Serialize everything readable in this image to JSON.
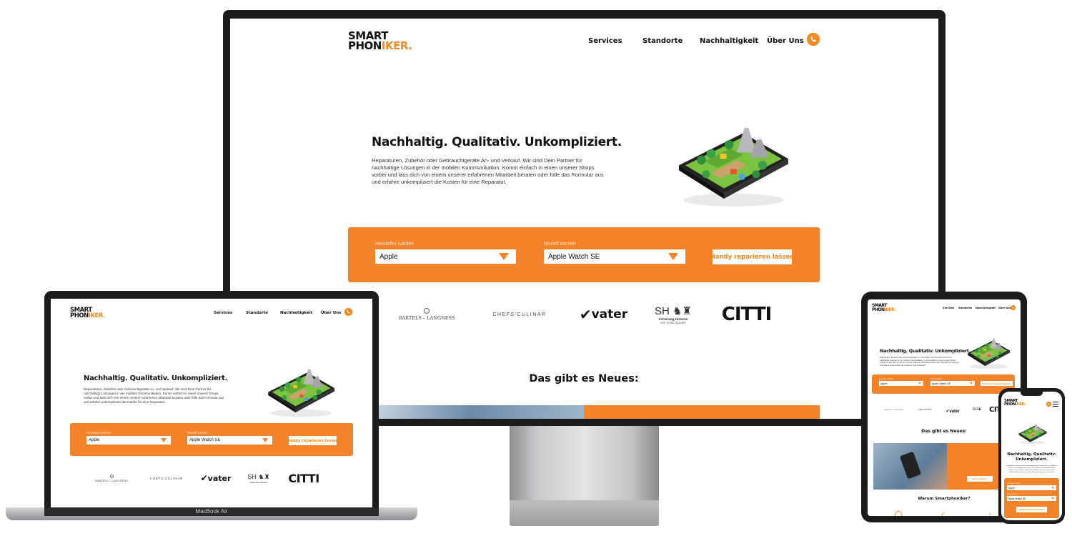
{
  "site": {
    "logo_line1": "SMART",
    "logo_line2_main": "PHON",
    "logo_line2_accent": "IKER.",
    "nav": [
      "Services",
      "Standorte",
      "Nachhaltigkeit",
      "Über Uns"
    ],
    "hero_title": "Nachhaltig. Qualitativ. Unkompliziert.",
    "hero_title_phone_l1": "Nachhaltig. Qualitativ.",
    "hero_title_phone_l2": "Unkompliziert.",
    "hero_text": "Reparaturen, Zubehör oder Gebrauchtgeräte An- und Verkauf. Wir sind Dein Partner für nachhaltige Lösungen in der mobilen Kommunikation. Komm einfach in einen unserer Shops vorbei und lass dich von einem unserer erfahrenen Mitarbeit beraten oder fülle das Formular aus und erfahre unkompliziert die Kosten für eine Reparatur.",
    "form": {
      "manufacturer_label": "Hersteller wählen",
      "manufacturer_value": "Apple",
      "model_label": "Modell wählen",
      "model_value": "Apple Watch SE",
      "cta": "Handy reparieren lassen"
    },
    "partner_logos": {
      "bartels": "BARTELS – LANGNESS",
      "chefs": "CHEFS'CULINAR",
      "vater": "vater",
      "sh": "SH",
      "sh_sub1": "Schleswig-Holstein",
      "sh_sub2": "Der echte Norden",
      "citti": "CITTI"
    },
    "news_title": "Das gibt es Neues:",
    "why_title": "Warum Smartphoniker?",
    "news_cta": "Mehr erfahren"
  },
  "device_labels": {
    "laptop": "MacBook Air"
  },
  "colors": {
    "accent": "#f28a21",
    "form_bg": "#f5832a",
    "device_frame": "#1c1c1e"
  },
  "icons": {
    "phone_button": "phone-icon",
    "dropdown": "chevron-down-icon",
    "menu": "hamburger-icon"
  }
}
